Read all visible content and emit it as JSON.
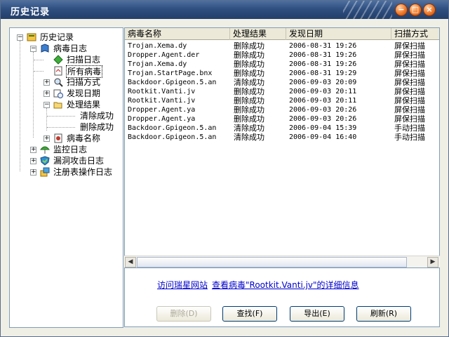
{
  "window": {
    "title": "历史记录",
    "min_glyph": "−",
    "max_glyph": "□",
    "close_glyph": "×"
  },
  "tree": {
    "root": "历史记录",
    "virus_log": "病毒日志",
    "scan_log": "扫描日志",
    "all_viruses": "所有病毒",
    "scan_method": "扫描方式",
    "found_date": "发现日期",
    "process_result": "处理结果",
    "clear_success": "清除成功",
    "delete_success": "删除成功",
    "virus_name": "病毒名称",
    "monitor_log": "监控日志",
    "vuln_attack_log": "漏洞攻击日志",
    "registry_log": "注册表操作日志",
    "expand": "+",
    "collapse": "−"
  },
  "list": {
    "columns": [
      "病毒名称",
      "处理结果",
      "发现日期",
      "扫描方式"
    ],
    "rows": [
      [
        "Trojan.Xema.dy",
        "删除成功",
        "2006-08-31 19:26",
        "屏保扫描"
      ],
      [
        "Dropper.Agent.der",
        "删除成功",
        "2006-08-31 19:26",
        "屏保扫描"
      ],
      [
        "Trojan.Xema.dy",
        "删除成功",
        "2006-08-31 19:26",
        "屏保扫描"
      ],
      [
        "Trojan.StartPage.bnx",
        "删除成功",
        "2006-08-31 19:29",
        "屏保扫描"
      ],
      [
        "Backdoor.Gpigeon.5.an",
        "清除成功",
        "2006-09-03 20:09",
        "屏保扫描"
      ],
      [
        "Rootkit.Vanti.jv",
        "删除成功",
        "2006-09-03 20:11",
        "屏保扫描"
      ],
      [
        "Rootkit.Vanti.jv",
        "删除成功",
        "2006-09-03 20:11",
        "屏保扫描"
      ],
      [
        "Dropper.Agent.ya",
        "删除成功",
        "2006-09-03 20:26",
        "屏保扫描"
      ],
      [
        "Dropper.Agent.ya",
        "删除成功",
        "2006-09-03 20:26",
        "屏保扫描"
      ],
      [
        "Backdoor.Gpigeon.5.an",
        "清除成功",
        "2006-09-04 15:39",
        "手动扫描"
      ],
      [
        "Backdoor.Gpigeon.5.an",
        "清除成功",
        "2006-09-04 16:40",
        "手动扫描"
      ]
    ],
    "scroll_left": "◀",
    "scroll_right": "▶"
  },
  "info": {
    "visit_site": "访问瑞星网站",
    "view_detail": "查看病毒\"Rootkit.Vanti.jv\"的详细信息"
  },
  "buttons": {
    "delete": "删除(D)",
    "find": "查找(F)",
    "export": "导出(E)",
    "refresh": "刷新(R)"
  }
}
